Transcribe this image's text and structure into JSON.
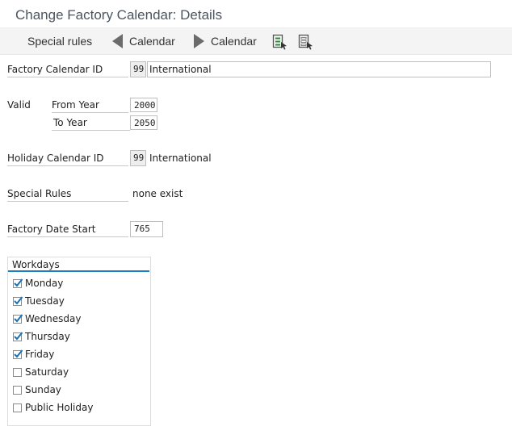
{
  "window": {
    "title": "Change Factory Calendar: Details"
  },
  "toolbar": {
    "special_rules": "Special rules",
    "prev_calendar": "Calendar",
    "next_calendar": "Calendar",
    "icon_1": "select-all-icon",
    "icon_2": "deselect-all-icon"
  },
  "form": {
    "factory_calendar_id_label": "Factory Calendar ID",
    "factory_calendar_id": "99",
    "factory_calendar_name": "International",
    "valid_label": "Valid",
    "from_year_label": "From Year",
    "from_year": "2000",
    "to_year_label": "To Year",
    "to_year": "2050",
    "holiday_calendar_id_label": "Holiday Calendar ID",
    "holiday_calendar_id": "99",
    "holiday_calendar_name": "International",
    "special_rules_label": "Special Rules",
    "special_rules_value": "none exist",
    "factory_date_start_label": "Factory Date Start",
    "factory_date_start": "765"
  },
  "workdays": {
    "title": "Workdays",
    "days": [
      {
        "label": "Monday",
        "checked": true
      },
      {
        "label": "Tuesday",
        "checked": true
      },
      {
        "label": "Wednesday",
        "checked": true
      },
      {
        "label": "Thursday",
        "checked": true
      },
      {
        "label": "Friday",
        "checked": true
      },
      {
        "label": "Saturday",
        "checked": false
      },
      {
        "label": "Sunday",
        "checked": false
      },
      {
        "label": "Public Holiday",
        "checked": false
      }
    ]
  },
  "colors": {
    "accent": "#1b7fc1",
    "check": "#1b6fb0"
  }
}
